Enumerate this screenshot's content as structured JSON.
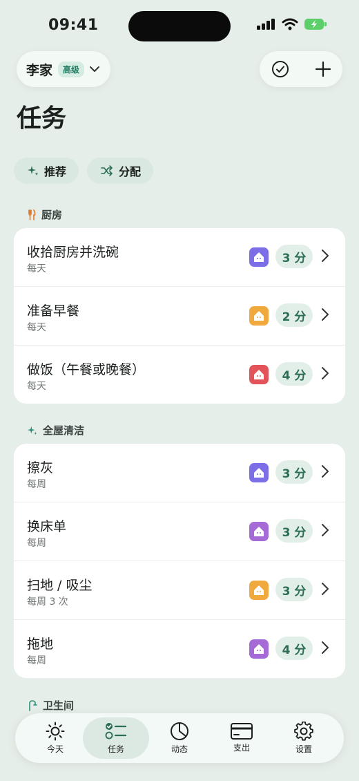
{
  "status": {
    "time": "09:41"
  },
  "household": {
    "name": "李家",
    "plan": "高级"
  },
  "page": {
    "title": "任务"
  },
  "chips": [
    {
      "label": "推荐",
      "icon": "sparkle-icon"
    },
    {
      "label": "分配",
      "icon": "shuffle-icon"
    }
  ],
  "sections": [
    {
      "title": "厨房",
      "icon": "fork-knife-icon",
      "tasks": [
        {
          "title": "收拾厨房并洗碗",
          "freq": "每天",
          "points": "3 分",
          "assignee_color": "#7c6ee6"
        },
        {
          "title": "准备早餐",
          "freq": "每天",
          "points": "2 分",
          "assignee_color": "#f0a93d"
        },
        {
          "title": "做饭（午餐或晚餐）",
          "freq": "每天",
          "points": "4 分",
          "assignee_color": "#e2545a"
        }
      ]
    },
    {
      "title": "全屋清洁",
      "icon": "sparkle-icon",
      "tasks": [
        {
          "title": "擦灰",
          "freq": "每周",
          "points": "3 分",
          "assignee_color": "#7c6ee6"
        },
        {
          "title": "换床单",
          "freq": "每周",
          "points": "3 分",
          "assignee_color": "#a66ad6"
        },
        {
          "title": "扫地 / 吸尘",
          "freq": "每周 3 次",
          "points": "3 分",
          "assignee_color": "#f0a93d"
        },
        {
          "title": "拖地",
          "freq": "每周",
          "points": "4 分",
          "assignee_color": "#a66ad6"
        }
      ]
    },
    {
      "title": "卫生间",
      "icon": "faucet-icon"
    }
  ],
  "tabs": [
    {
      "label": "今天",
      "icon": "sun-icon"
    },
    {
      "label": "任务",
      "icon": "checklist-icon"
    },
    {
      "label": "动态",
      "icon": "pie-chart-icon"
    },
    {
      "label": "支出",
      "icon": "card-icon"
    },
    {
      "label": "设置",
      "icon": "gear-icon"
    }
  ],
  "colors": {
    "accent": "#2c6d55",
    "background": "#e6eee9"
  }
}
